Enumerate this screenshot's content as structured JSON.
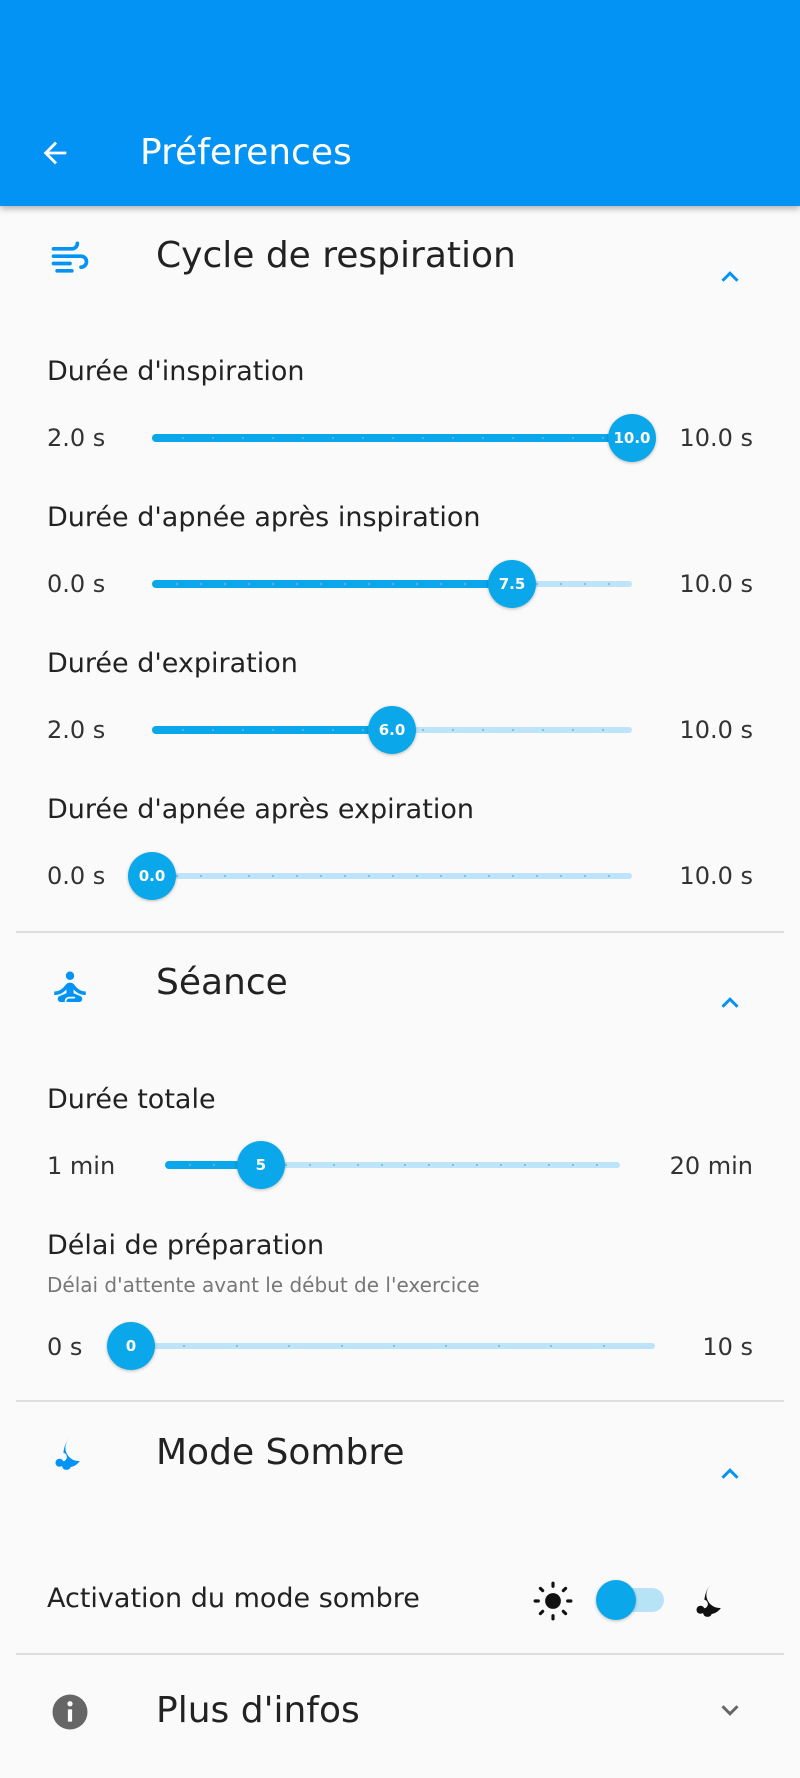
{
  "appbar": {
    "title": "Préferences",
    "back_icon": "arrow-left-icon"
  },
  "colors": {
    "primary": "#0393f4",
    "accent": "#0aa7ea",
    "track": "#bde4f8"
  },
  "sections": {
    "breathing": {
      "title": "Cycle de respiration",
      "icon": "wind-icon",
      "expanded": true,
      "prefs": [
        {
          "label": "Durée d'inspiration",
          "min_label": "2.0 s",
          "max_label": "10.0 s",
          "value_label": "10.0",
          "min": 2,
          "max": 10,
          "value": 10,
          "ticks": 16
        },
        {
          "label": "Durée d'apnée après inspiration",
          "min_label": "0.0 s",
          "max_label": "10.0 s",
          "value_label": "7.5",
          "min": 0,
          "max": 10,
          "value": 7.5,
          "ticks": 20
        },
        {
          "label": "Durée d'expiration",
          "min_label": "2.0 s",
          "max_label": "10.0 s",
          "value_label": "6.0",
          "min": 2,
          "max": 10,
          "value": 6,
          "ticks": 16
        },
        {
          "label": "Durée d'apnée après expiration",
          "min_label": "0.0 s",
          "max_label": "10.0 s",
          "value_label": "0.0",
          "min": 0,
          "max": 10,
          "value": 0,
          "ticks": 20
        }
      ]
    },
    "session": {
      "title": "Séance",
      "icon": "meditation-icon",
      "expanded": true,
      "prefs": [
        {
          "label": "Durée totale",
          "min_label": "1 min",
          "max_label": "20 min",
          "value_label": "5",
          "min": 1,
          "max": 20,
          "value": 5,
          "ticks": 19
        },
        {
          "label": "Délai de préparation",
          "subtitle": "Délai d'attente avant le début de l'exercice",
          "min_label": "0 s",
          "max_label": "10 s",
          "value_label": "0",
          "min": 0,
          "max": 10,
          "value": 0,
          "ticks": 10
        }
      ]
    },
    "dark": {
      "title": "Mode Sombre",
      "icon": "moon-icon",
      "expanded": true,
      "toggle_label": "Activation du mode sombre",
      "toggle_on": false
    },
    "info": {
      "title": "Plus d'infos",
      "icon": "info-icon",
      "expanded": false
    }
  }
}
